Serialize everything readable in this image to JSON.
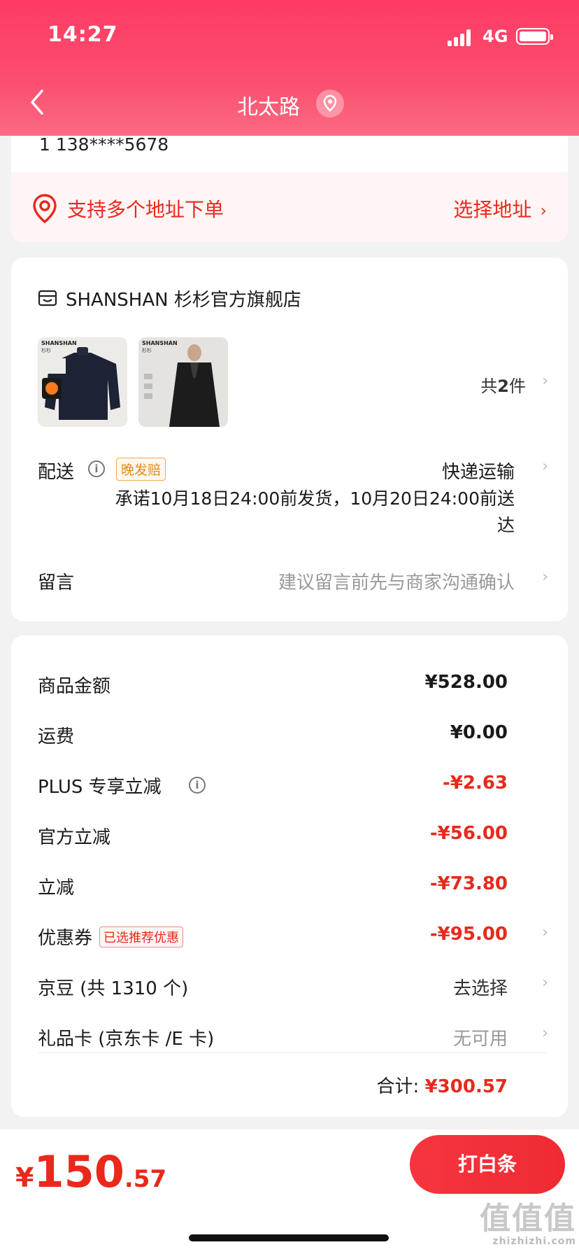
{
  "status_bar": {
    "time": "14:27",
    "network": "4G"
  },
  "nav": {
    "title": "北太路"
  },
  "address": {
    "phone": "1 138****5678",
    "multi_label": "支持多个地址下单",
    "select_label": "选择地址",
    "chevron": "›"
  },
  "store": {
    "name": "SHANSHAN 杉杉官方旗舰店",
    "products": [
      {
        "brand": "SHANSHAN",
        "brand_cn": "杉杉"
      },
      {
        "brand": "SHANSHAN",
        "brand_cn": "杉杉"
      }
    ],
    "count_prefix": "共",
    "count_value": "2",
    "count_suffix": "件",
    "delivery_label": "配送",
    "info_glyph": "i",
    "late_badge": "晚发赔",
    "delivery_method": "快递运输",
    "delivery_promise": "承诺10月18日24:00前发货，10月20日24:00前送达",
    "message_label": "留言",
    "message_placeholder": "建议留言前先与商家沟通确认",
    "chevron": "›"
  },
  "price": {
    "rows": [
      {
        "label": "商品金额",
        "value": "¥528.00"
      },
      {
        "label": "运费",
        "value": "¥0.00"
      },
      {
        "label": "PLUS 专享立减",
        "value": "-¥2.63"
      },
      {
        "label": "官方立减",
        "value": "-¥56.00"
      },
      {
        "label": "立减",
        "value": "-¥73.80"
      },
      {
        "label": "优惠券",
        "badge": "已选推荐优惠",
        "value": "-¥95.00"
      },
      {
        "label": "京豆 (共 1310 个)",
        "value": "去选择"
      },
      {
        "label": "礼品卡 (京东卡 /E 卡)",
        "value": "无可用"
      }
    ],
    "total_label": "合计:",
    "total_value": "¥300.57",
    "chevron": "›"
  },
  "bottom": {
    "currency": "¥",
    "amount_int": "150",
    "amount_dec": ".57",
    "pay_button": "打白条"
  },
  "watermark": {
    "big": "值值值",
    "small": "zhizhizhi.com"
  },
  "colors": {
    "brand_red": "#e8291b",
    "header_pink": "#ff3a63",
    "button_red": "#f6353f"
  }
}
